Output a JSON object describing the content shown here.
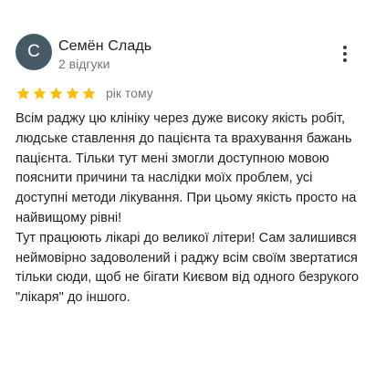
{
  "review": {
    "author": {
      "initial": "С",
      "name": "Семён Сладь",
      "meta": "2 відгуки",
      "avatar_color": "#455a64"
    },
    "more_icon": "more-vert-icon",
    "rating": {
      "stars": 5,
      "max": 5,
      "star_color": "#fbbc04",
      "star_icon": "star-icon"
    },
    "date": "рік тому",
    "paragraphs": [
      "Всім раджу цю клініку через дуже високу якість робіт, людське ставлення до пацієнта та врахування бажань пацієнта. Тільки тут мені змогли доступною мовою пояснити причини та наслідки моїх проблем, усі доступні методи лікування. При цьому якість просто на найвищому рівні!",
      "Тут працюють лікарі до великої літери! Сам залишився неймовірно задоволений і раджу всім своїм звертатися тільки сюди, щоб не бігати Києвом від одного безрукого \"лікаря\" до іншого."
    ]
  }
}
